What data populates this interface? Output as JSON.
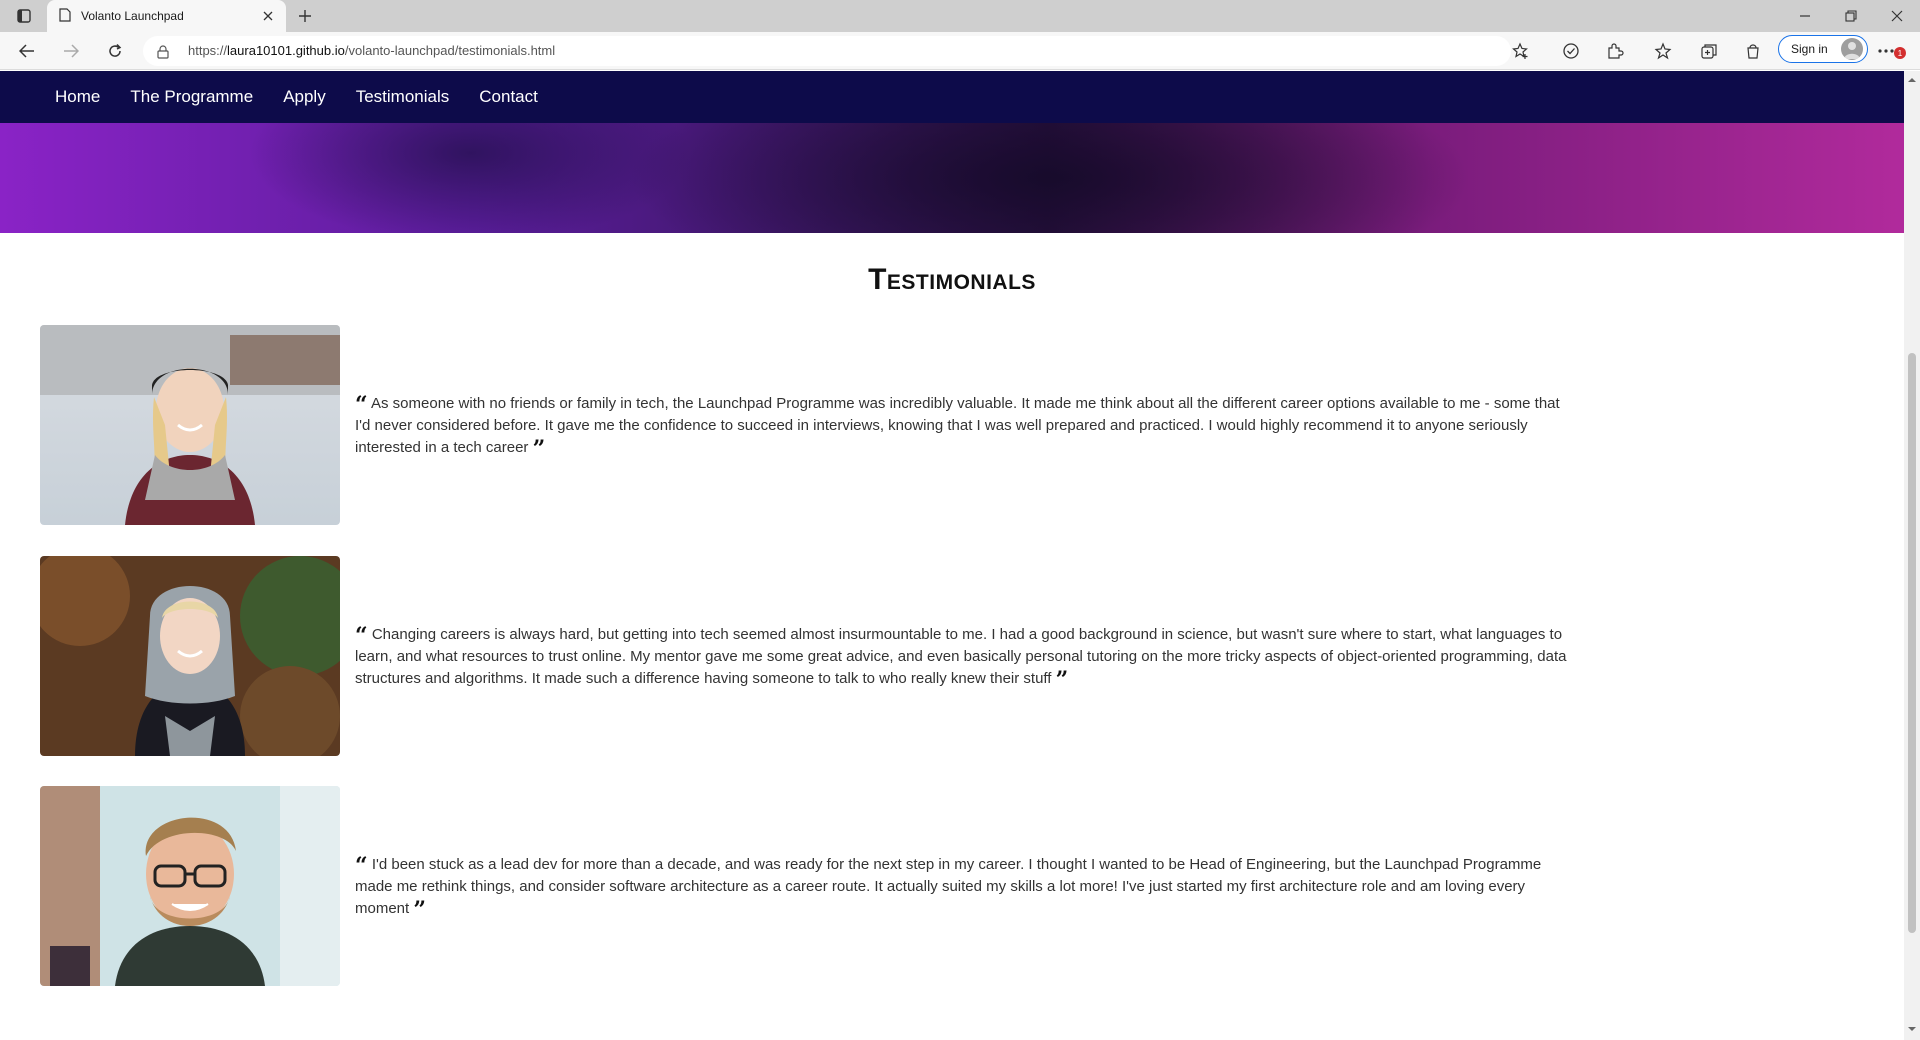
{
  "browser": {
    "tab_title": "Volanto Launchpad",
    "url_prefix": "https://",
    "url_host": "laura10101.github.io",
    "url_path": "/volanto-launchpad/testimonials.html",
    "signin_label": "Sign in",
    "notification_count": "1"
  },
  "nav": {
    "items": [
      {
        "label": "Home"
      },
      {
        "label": "The Programme"
      },
      {
        "label": "Apply"
      },
      {
        "label": "Testimonials"
      },
      {
        "label": "Contact"
      }
    ]
  },
  "page": {
    "heading": "Testimonials"
  },
  "testimonials": [
    {
      "text": "As someone with no friends or family in tech, the Launchpad Programme was incredibly valuable. It made me think about all the different career options available to me - some that I'd never considered before. It gave me the confidence to succeed in interviews, knowing that I was well prepared and practiced. I would highly recommend it to anyone seriously interested in a tech career"
    },
    {
      "text": "Changing careers is always hard, but getting into tech seemed almost insurmountable to me. I had a good background in science, but wasn't sure where to start, what languages to learn, and what resources to trust online. My mentor gave me some great advice, and even basically personal tutoring on the more tricky aspects of object-oriented programming, data structures and algorithms. It made such a difference having someone to talk to who really knew their stuff"
    },
    {
      "text": "I'd been stuck as a lead dev for more than a decade, and was ready for the next step in my career. I thought I wanted to be Head of Engineering, but the Launchpad Programme made me rethink things, and consider software architecture as a career route. It actually suited my skills a lot more! I've just started my first architecture role and am loving every moment"
    }
  ],
  "colors": {
    "navbar_bg": "#0d0b4a",
    "hero_left": "#8a23c6",
    "hero_right": "#b12a9c"
  }
}
